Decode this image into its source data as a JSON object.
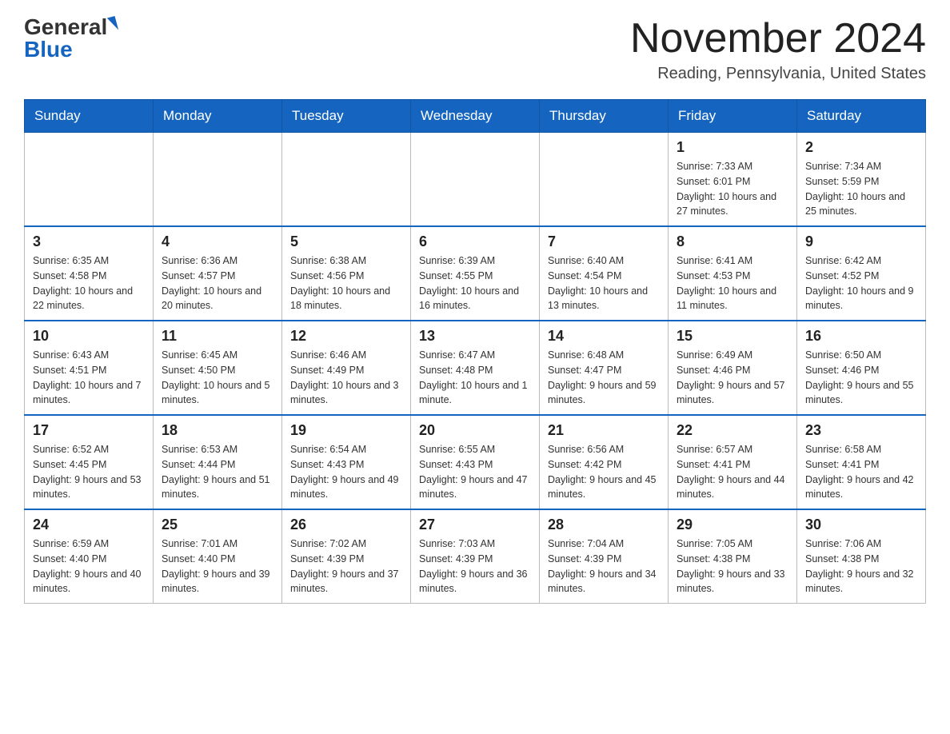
{
  "header": {
    "logo_general": "General",
    "logo_blue": "Blue",
    "month_title": "November 2024",
    "location": "Reading, Pennsylvania, United States"
  },
  "weekdays": [
    "Sunday",
    "Monday",
    "Tuesday",
    "Wednesday",
    "Thursday",
    "Friday",
    "Saturday"
  ],
  "rows": [
    [
      {
        "day": "",
        "info": ""
      },
      {
        "day": "",
        "info": ""
      },
      {
        "day": "",
        "info": ""
      },
      {
        "day": "",
        "info": ""
      },
      {
        "day": "",
        "info": ""
      },
      {
        "day": "1",
        "info": "Sunrise: 7:33 AM\nSunset: 6:01 PM\nDaylight: 10 hours and 27 minutes."
      },
      {
        "day": "2",
        "info": "Sunrise: 7:34 AM\nSunset: 5:59 PM\nDaylight: 10 hours and 25 minutes."
      }
    ],
    [
      {
        "day": "3",
        "info": "Sunrise: 6:35 AM\nSunset: 4:58 PM\nDaylight: 10 hours and 22 minutes."
      },
      {
        "day": "4",
        "info": "Sunrise: 6:36 AM\nSunset: 4:57 PM\nDaylight: 10 hours and 20 minutes."
      },
      {
        "day": "5",
        "info": "Sunrise: 6:38 AM\nSunset: 4:56 PM\nDaylight: 10 hours and 18 minutes."
      },
      {
        "day": "6",
        "info": "Sunrise: 6:39 AM\nSunset: 4:55 PM\nDaylight: 10 hours and 16 minutes."
      },
      {
        "day": "7",
        "info": "Sunrise: 6:40 AM\nSunset: 4:54 PM\nDaylight: 10 hours and 13 minutes."
      },
      {
        "day": "8",
        "info": "Sunrise: 6:41 AM\nSunset: 4:53 PM\nDaylight: 10 hours and 11 minutes."
      },
      {
        "day": "9",
        "info": "Sunrise: 6:42 AM\nSunset: 4:52 PM\nDaylight: 10 hours and 9 minutes."
      }
    ],
    [
      {
        "day": "10",
        "info": "Sunrise: 6:43 AM\nSunset: 4:51 PM\nDaylight: 10 hours and 7 minutes."
      },
      {
        "day": "11",
        "info": "Sunrise: 6:45 AM\nSunset: 4:50 PM\nDaylight: 10 hours and 5 minutes."
      },
      {
        "day": "12",
        "info": "Sunrise: 6:46 AM\nSunset: 4:49 PM\nDaylight: 10 hours and 3 minutes."
      },
      {
        "day": "13",
        "info": "Sunrise: 6:47 AM\nSunset: 4:48 PM\nDaylight: 10 hours and 1 minute."
      },
      {
        "day": "14",
        "info": "Sunrise: 6:48 AM\nSunset: 4:47 PM\nDaylight: 9 hours and 59 minutes."
      },
      {
        "day": "15",
        "info": "Sunrise: 6:49 AM\nSunset: 4:46 PM\nDaylight: 9 hours and 57 minutes."
      },
      {
        "day": "16",
        "info": "Sunrise: 6:50 AM\nSunset: 4:46 PM\nDaylight: 9 hours and 55 minutes."
      }
    ],
    [
      {
        "day": "17",
        "info": "Sunrise: 6:52 AM\nSunset: 4:45 PM\nDaylight: 9 hours and 53 minutes."
      },
      {
        "day": "18",
        "info": "Sunrise: 6:53 AM\nSunset: 4:44 PM\nDaylight: 9 hours and 51 minutes."
      },
      {
        "day": "19",
        "info": "Sunrise: 6:54 AM\nSunset: 4:43 PM\nDaylight: 9 hours and 49 minutes."
      },
      {
        "day": "20",
        "info": "Sunrise: 6:55 AM\nSunset: 4:43 PM\nDaylight: 9 hours and 47 minutes."
      },
      {
        "day": "21",
        "info": "Sunrise: 6:56 AM\nSunset: 4:42 PM\nDaylight: 9 hours and 45 minutes."
      },
      {
        "day": "22",
        "info": "Sunrise: 6:57 AM\nSunset: 4:41 PM\nDaylight: 9 hours and 44 minutes."
      },
      {
        "day": "23",
        "info": "Sunrise: 6:58 AM\nSunset: 4:41 PM\nDaylight: 9 hours and 42 minutes."
      }
    ],
    [
      {
        "day": "24",
        "info": "Sunrise: 6:59 AM\nSunset: 4:40 PM\nDaylight: 9 hours and 40 minutes."
      },
      {
        "day": "25",
        "info": "Sunrise: 7:01 AM\nSunset: 4:40 PM\nDaylight: 9 hours and 39 minutes."
      },
      {
        "day": "26",
        "info": "Sunrise: 7:02 AM\nSunset: 4:39 PM\nDaylight: 9 hours and 37 minutes."
      },
      {
        "day": "27",
        "info": "Sunrise: 7:03 AM\nSunset: 4:39 PM\nDaylight: 9 hours and 36 minutes."
      },
      {
        "day": "28",
        "info": "Sunrise: 7:04 AM\nSunset: 4:39 PM\nDaylight: 9 hours and 34 minutes."
      },
      {
        "day": "29",
        "info": "Sunrise: 7:05 AM\nSunset: 4:38 PM\nDaylight: 9 hours and 33 minutes."
      },
      {
        "day": "30",
        "info": "Sunrise: 7:06 AM\nSunset: 4:38 PM\nDaylight: 9 hours and 32 minutes."
      }
    ]
  ]
}
